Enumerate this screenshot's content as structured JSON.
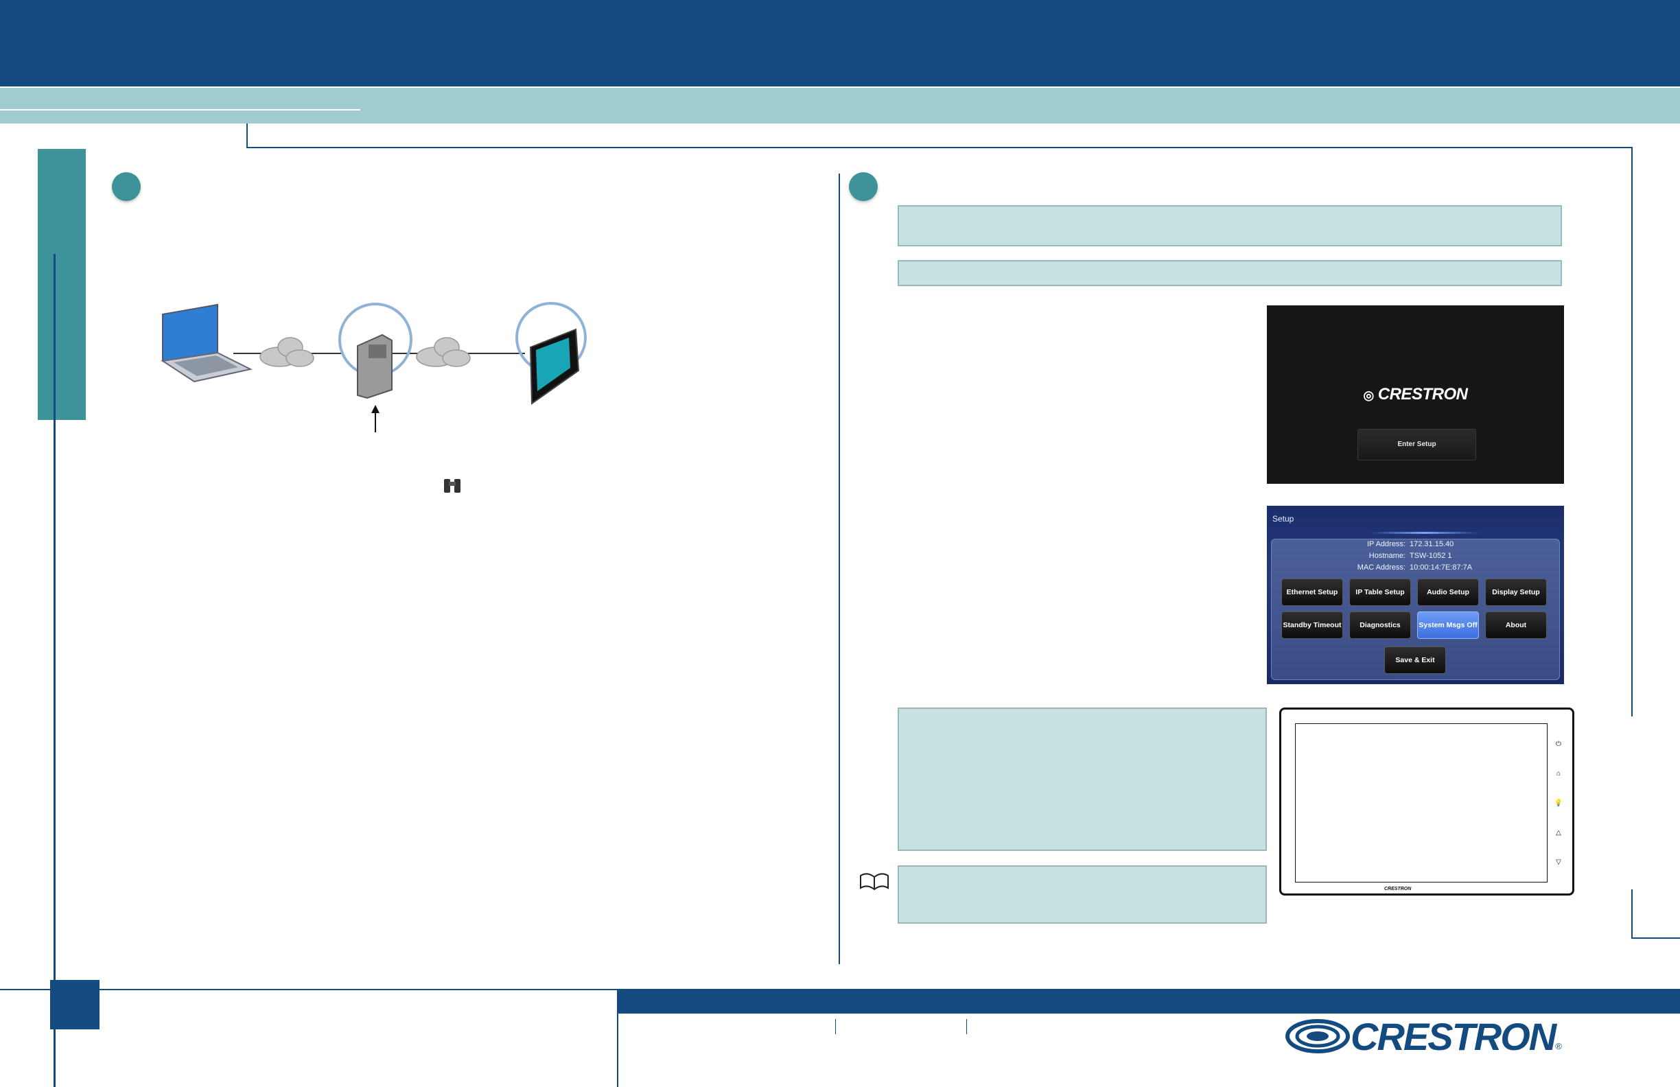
{
  "splash_screen": {
    "logo_text": "CRESTRON",
    "button_label": "Enter Setup"
  },
  "setup_screen": {
    "title": "Setup",
    "info": [
      {
        "label": "IP Address:",
        "value": "172.31.15.40"
      },
      {
        "label": "Hostname:",
        "value": "TSW-1052 1"
      },
      {
        "label": "MAC Address:",
        "value": "10:00:14:7E:87:7A"
      }
    ],
    "buttons": {
      "ethernet_setup": "Ethernet Setup",
      "ip_table_setup": "IP Table Setup",
      "audio_setup": "Audio Setup",
      "display_setup": "Display Setup",
      "standby_timeout": "Standby Timeout",
      "diagnostics": "Diagnostics",
      "system_msgs_off": "System Msgs Off",
      "about": "About",
      "save_exit": "Save & Exit"
    }
  },
  "device": {
    "brand": "CRESTRON",
    "side_icons": [
      "power-icon",
      "home-icon",
      "lightbulb-icon",
      "up-triangle-icon",
      "down-triangle-icon"
    ]
  },
  "footer": {
    "logo_text": "CRESTRON",
    "registered_mark": "®"
  },
  "colors": {
    "navy": "#134a7f",
    "teal": "#3d9399",
    "light_teal": "#a0cbcf",
    "info_box": "#c7e0e2"
  }
}
